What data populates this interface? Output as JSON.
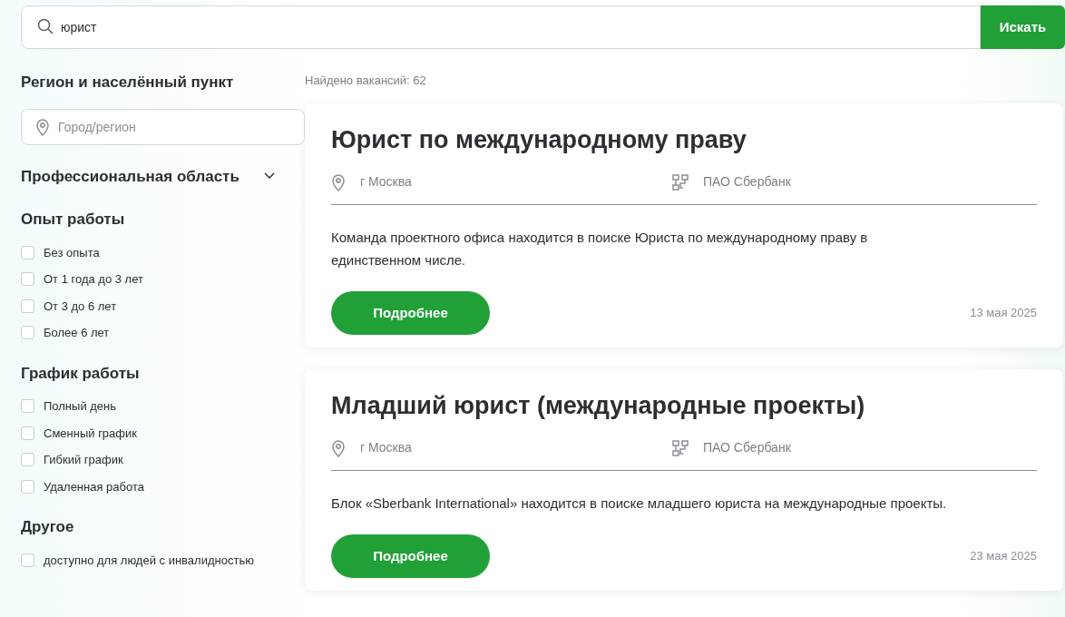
{
  "search": {
    "value": "юрист",
    "button": "Искать"
  },
  "filters": [
    {
      "kind": "field",
      "title": "Регион и населённый пункт",
      "placeholder": "Город/регион"
    },
    {
      "kind": "collapsible",
      "title": "Профессиональная область",
      "expanded": false
    },
    {
      "kind": "checkboxes",
      "title": "Опыт работы",
      "options": [
        {
          "label": "Без опыта",
          "checked": false
        },
        {
          "label": "От 1 года до 3 лет",
          "checked": false
        },
        {
          "label": "От 3 до 6 лет",
          "checked": false
        },
        {
          "label": "Более 6 лет",
          "checked": false
        }
      ]
    },
    {
      "kind": "checkboxes",
      "title": "График работы",
      "options": [
        {
          "label": "Полный день",
          "checked": false
        },
        {
          "label": "Сменный график",
          "checked": false
        },
        {
          "label": "Гибкий график",
          "checked": false
        },
        {
          "label": "Удаленная работа",
          "checked": false
        }
      ]
    },
    {
      "kind": "checkboxes",
      "title": "Другое",
      "options": [
        {
          "label": "доступно для людей с инвалидностью",
          "checked": false
        }
      ]
    }
  ],
  "results_count": "Найдено вакансий: 62",
  "vacancies": [
    {
      "title": "Юрист по международному праву",
      "city": "г Москва",
      "company": "ПАО Сбербанк",
      "description": "Команда проектного офиса находится в поиске Юриста по международному праву в единственном числе.",
      "button": "Подробнее",
      "date": "13 мая 2025"
    },
    {
      "title": "Младший юрист (международные проекты)",
      "city": "г Москва",
      "company": "ПАО Сбербанк",
      "description": "Блок «Sberbank International» находится в поиске младшего юриста на международные проекты.",
      "button": "Подробнее",
      "date": "23 мая 2025"
    }
  ]
}
